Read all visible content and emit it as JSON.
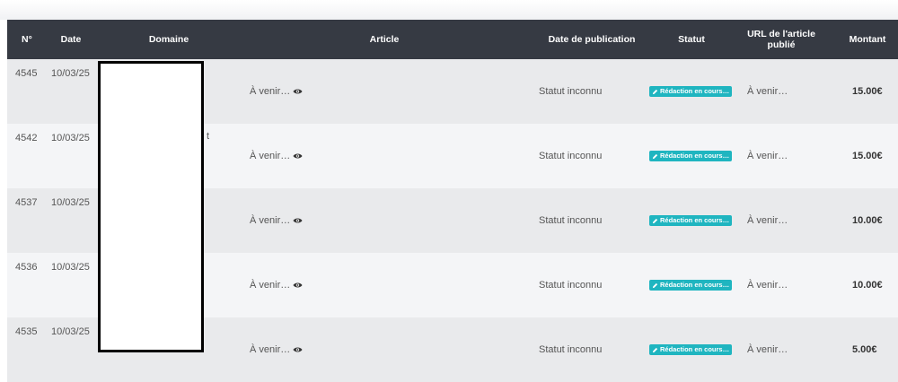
{
  "table": {
    "columns": {
      "num": "N°",
      "date": "Date",
      "domain": "Domaine",
      "article": "Article",
      "pub": "Date de publication",
      "statut": "Statut",
      "url": "URL de l'article publié",
      "amount": "Montant"
    },
    "rows": [
      {
        "num": "4545",
        "date": "10/03/25",
        "article": "À venir…",
        "pub": "Statut inconnu",
        "statut": "Rédaction en cours…",
        "url": "À venir…",
        "amount": "15.00€"
      },
      {
        "num": "4542",
        "date": "10/03/25",
        "article": "À venir…",
        "pub": "Statut inconnu",
        "statut": "Rédaction en cours…",
        "url": "À venir…",
        "amount": "15.00€",
        "domain_fragment": "t"
      },
      {
        "num": "4537",
        "date": "10/03/25",
        "article": "À venir…",
        "pub": "Statut inconnu",
        "statut": "Rédaction en cours…",
        "url": "À venir…",
        "amount": "10.00€"
      },
      {
        "num": "4536",
        "date": "10/03/25",
        "article": "À venir…",
        "pub": "Statut inconnu",
        "statut": "Rédaction en cours…",
        "url": "À venir…",
        "amount": "10.00€"
      },
      {
        "num": "4535",
        "date": "10/03/25",
        "article": "À venir…",
        "pub": "Statut inconnu",
        "statut": "Rédaction en cours…",
        "url": "À venir…",
        "amount": "5.00€"
      }
    ]
  },
  "colors": {
    "header_bg": "#363a43",
    "badge_bg": "#1fb5c0",
    "row_odd": "#e9eaec",
    "row_even": "#f4f5f7"
  },
  "icons": {
    "article": "eye-icon",
    "badge": "pencil-icon"
  }
}
